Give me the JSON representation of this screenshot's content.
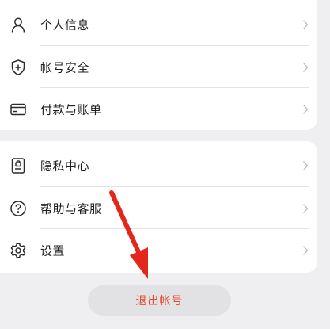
{
  "account_menu": {
    "items": [
      {
        "label": "个人信息",
        "icon": "person-icon"
      },
      {
        "label": "帐号安全",
        "icon": "shield-plus-icon"
      },
      {
        "label": "付款与账单",
        "icon": "card-icon"
      }
    ]
  },
  "settings_menu": {
    "items": [
      {
        "label": "隐私中心",
        "icon": "privacy-icon"
      },
      {
        "label": "帮助与客服",
        "icon": "help-icon"
      },
      {
        "label": "设置",
        "icon": "gear-icon"
      }
    ]
  },
  "logout": {
    "label": "退出帐号"
  },
  "colors": {
    "background": "#efeff1",
    "card": "#ffffff",
    "logout_text": "#e84a2e",
    "annotation_arrow": "#e4261d"
  }
}
